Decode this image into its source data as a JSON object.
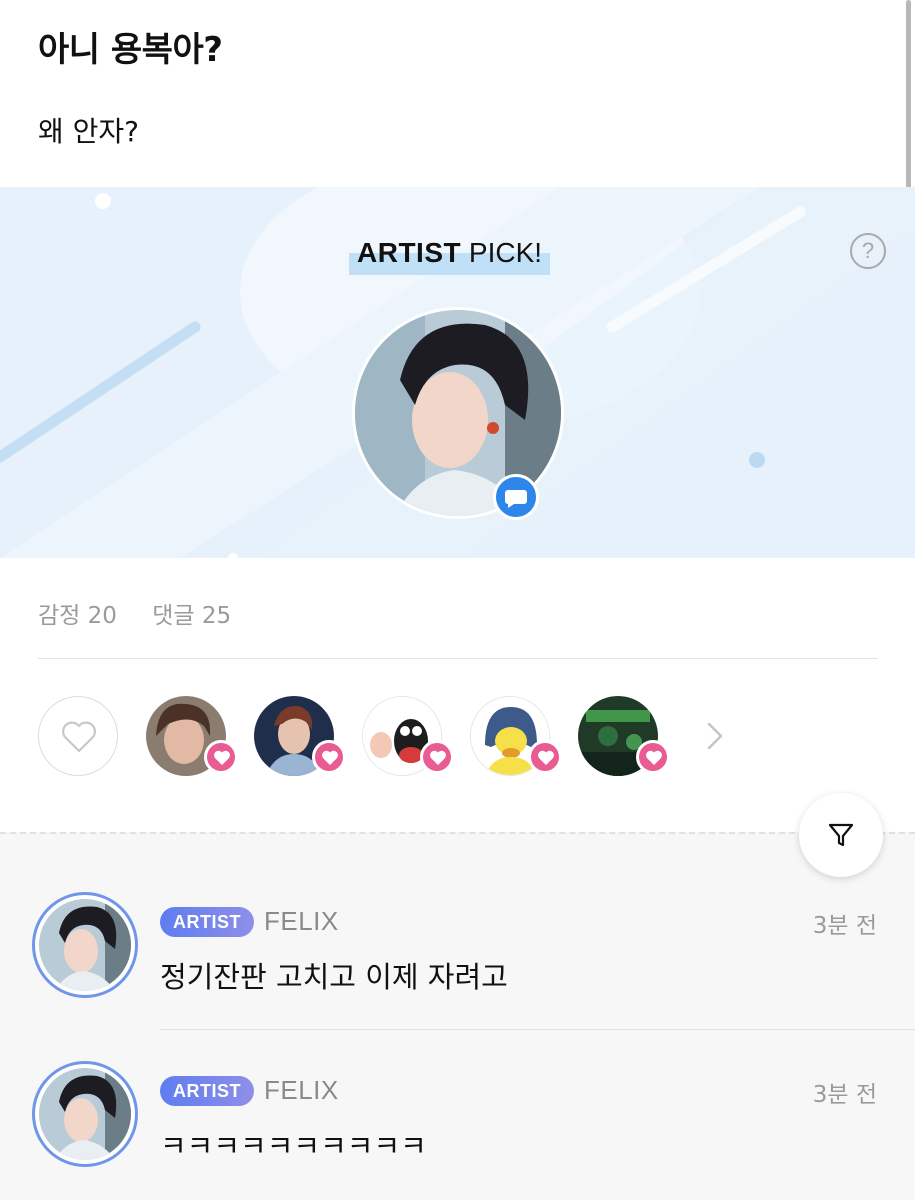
{
  "post": {
    "title": "아니 용복아?",
    "body": "왜 안자?"
  },
  "artist_pick": {
    "label_bold": "ARTIST",
    "label_rest": " PICK!",
    "help_icon": "question-circle-icon",
    "badge_icon": "speech-bubble-icon"
  },
  "stats": {
    "emotions": "감정 20",
    "comments": "댓글 25"
  },
  "reactions": {
    "like_icon": "heart-outline-icon",
    "more_icon": "chevron-right-icon",
    "reactor_count_shown": 5
  },
  "filter": {
    "icon": "filter-funnel-icon"
  },
  "comments": [
    {
      "badge": "ARTIST",
      "author": "FELIX",
      "time": "3분 전",
      "text": "정기잔판 고치고 이제 자려고"
    },
    {
      "badge": "ARTIST",
      "author": "FELIX",
      "time": "3분 전",
      "text": "ㅋㅋㅋㅋㅋㅋㅋㅋㅋㅋ"
    }
  ],
  "colors": {
    "banner_bg": "#e6f1fb",
    "accent_blue": "#2f86ea",
    "heart_pink": "#e85b93",
    "artist_badge": "#6f86ee",
    "muted_text": "#9a9a9a"
  }
}
